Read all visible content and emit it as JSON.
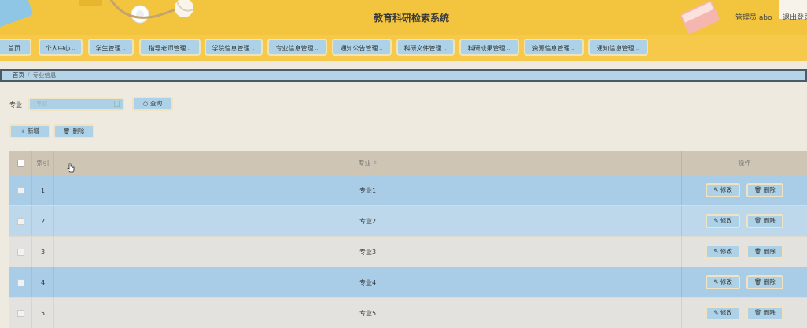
{
  "header": {
    "title": "教育科研检索系统",
    "admin": "管理员 abo",
    "logout": "退出登录"
  },
  "nav": {
    "items": [
      {
        "label": "首页"
      },
      {
        "label": "个人中心"
      },
      {
        "label": "学生管理"
      },
      {
        "label": "指导老师管理"
      },
      {
        "label": "学院信息管理"
      },
      {
        "label": "专业信息管理"
      },
      {
        "label": "通知公告管理"
      },
      {
        "label": "科研文件管理"
      },
      {
        "label": "科研成果管理"
      },
      {
        "label": "资源信息管理"
      },
      {
        "label": "通知信息管理"
      }
    ]
  },
  "breadcrumb": {
    "home": "首页",
    "current": "专业信息"
  },
  "search": {
    "label": "专业",
    "placeholder": "专业",
    "button": "查询"
  },
  "actions": {
    "add": "新增",
    "delete": "删除"
  },
  "table": {
    "columns": {
      "index": "索引",
      "major": "专业",
      "ops": "操作"
    },
    "rows": [
      {
        "index": "1",
        "major": "专业1"
      },
      {
        "index": "2",
        "major": "专业2"
      },
      {
        "index": "3",
        "major": "专业3"
      },
      {
        "index": "4",
        "major": "专业4"
      },
      {
        "index": "5",
        "major": "专业5"
      }
    ],
    "edit_label": "修改",
    "delete_label": "删除"
  },
  "colors": {
    "header": "#f3c53f",
    "nav_button": "#add1e6",
    "table_head": "#cec5b4"
  }
}
